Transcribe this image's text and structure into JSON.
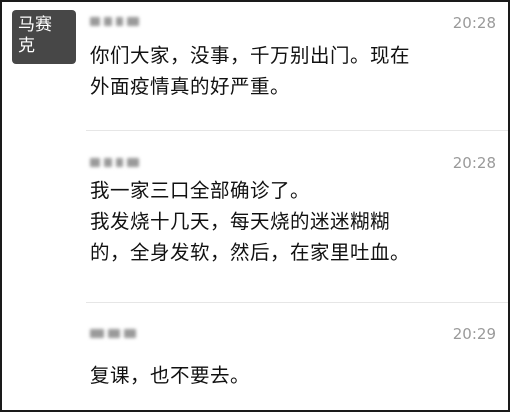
{
  "watermark": {
    "text": "马赛\n克"
  },
  "messages": [
    {
      "time": "20:28",
      "text": "你们大家，没事，千万别出门。现在\n外面疫情真的好严重。"
    },
    {
      "time": "20:28",
      "text": "我一家三口全部确诊了。\n我发烧十几天，每天烧的迷迷糊糊\n的，全身发软，然后，在家里吐血。"
    },
    {
      "time": "20:29",
      "text": "复课，也不要去。"
    }
  ]
}
